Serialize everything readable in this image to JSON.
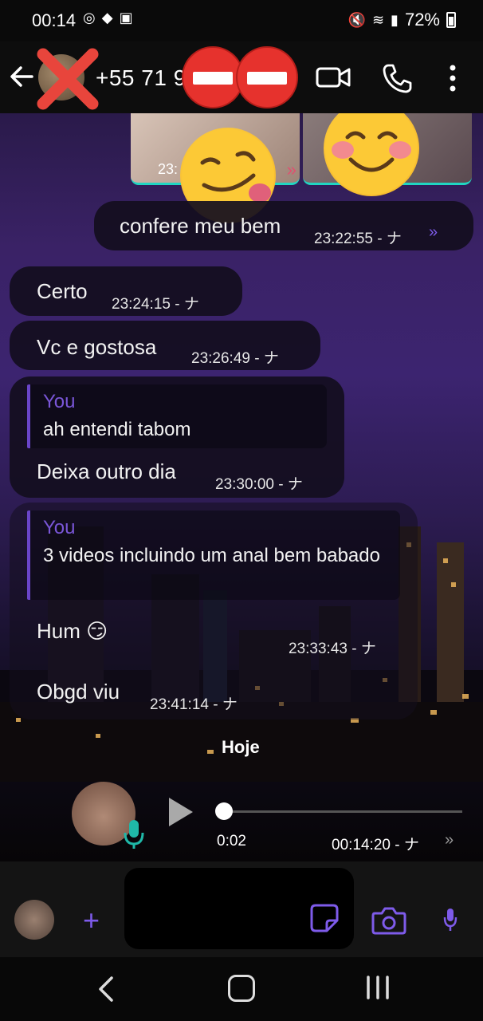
{
  "status_bar": {
    "time": "00:14",
    "left_icons": [
      "notification-icon",
      "android-icon",
      "gallery-icon"
    ],
    "right_icons": [
      "mute-icon",
      "wifi-icon",
      "signal-icon"
    ],
    "battery": "72%"
  },
  "header": {
    "contact_name": "+55 71 9",
    "icons": [
      "back-arrow-icon",
      "video-call-icon",
      "phone-call-icon",
      "more-options-icon"
    ]
  },
  "media": {
    "time": "23:",
    "overlay_emojis": [
      "smirk-tongue-emoji",
      "blush-smile-emoji"
    ]
  },
  "messages": [
    {
      "id": "m1",
      "direction": "outgoing",
      "text": "confere meu bem",
      "time": "23:22:55 - ナ",
      "ticks": "»"
    },
    {
      "id": "m2",
      "direction": "incoming",
      "text": "Certo",
      "time": "23:24:15 - ナ"
    },
    {
      "id": "m3",
      "direction": "incoming",
      "text": "Vc e gostosa",
      "time": "23:26:49 - ナ"
    },
    {
      "id": "m4",
      "direction": "incoming",
      "quote_author": "You",
      "quote_text": "ah entendi tabom",
      "text": "Deixa outro dia",
      "time": "23:30:00 - ナ"
    },
    {
      "id": "m5",
      "direction": "incoming",
      "quote_author": "You",
      "quote_text": "3 videos incluindo um anal bem babado",
      "text": "Hum 😏",
      "text2": "Obgd viu",
      "time": "23:33:43 - ナ",
      "time2": "23:41:14 - ナ"
    }
  ],
  "day_separator": "Hoje",
  "voice_message": {
    "duration": "0:02",
    "time": "00:14:20 - ナ",
    "ticks": "»",
    "progress": 0.0
  },
  "composer": {
    "placeholder": "",
    "icons": [
      "plus-icon",
      "sticker-icon",
      "camera-icon",
      "mic-icon"
    ]
  },
  "colors": {
    "accent": "#7e5bea",
    "bubble": "#140e1e",
    "no_entry_red": "#e6322d"
  }
}
